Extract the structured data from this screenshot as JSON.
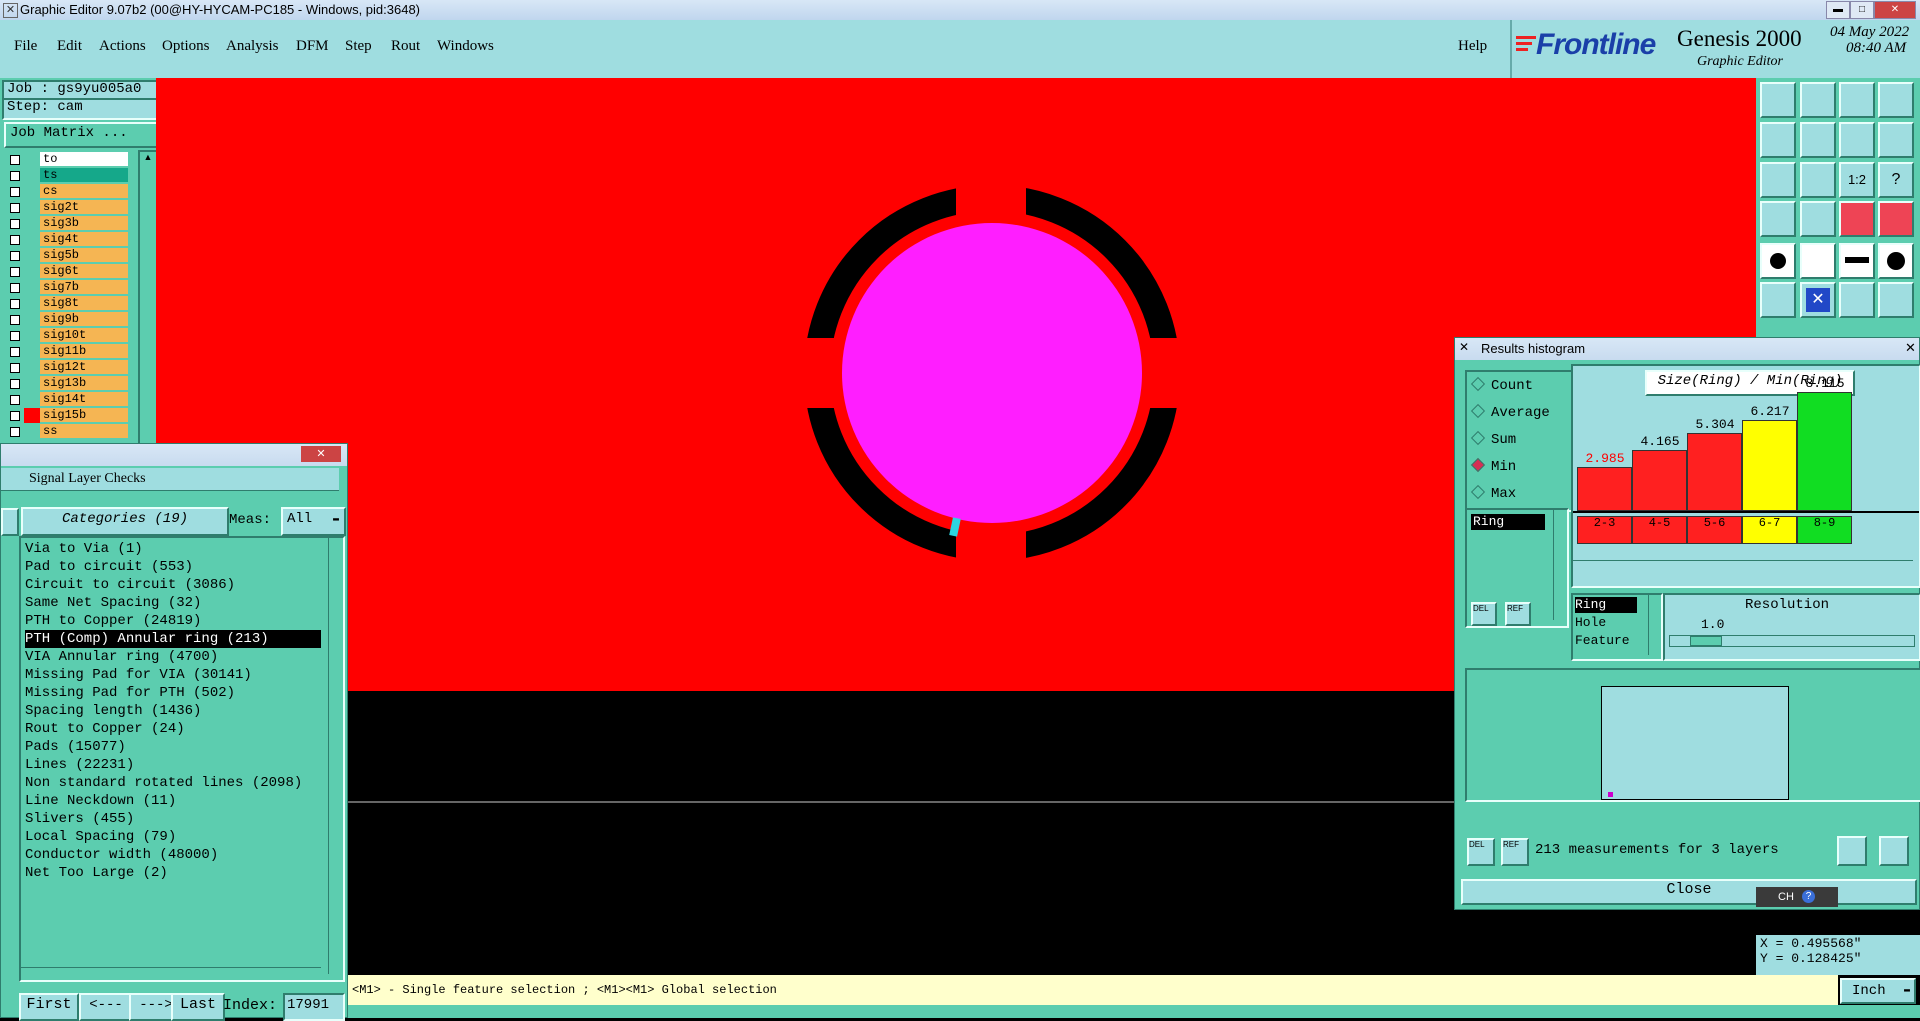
{
  "titlebar": {
    "title": "Graphic Editor 9.07b2 (00@HY-HYCAM-PC185 - Windows, pid:3648)"
  },
  "menu": [
    "File",
    "Edit",
    "Actions",
    "Options",
    "Analysis",
    "DFM",
    "Step",
    "Rout",
    "Windows"
  ],
  "help_label": "Help",
  "brand": {
    "logo": "Frontline",
    "product": "Genesis 2000",
    "subtitle": "Graphic Editor",
    "date": "04 May 2022",
    "time": "08:40 AM"
  },
  "job": {
    "job_label": "Job : gs9yu005a0",
    "step_label": "Step: cam",
    "matrix_button": "Job Matrix ..."
  },
  "layers": [
    {
      "name": "to",
      "color": "#ffffff"
    },
    {
      "name": "ts",
      "color": "#15a88a"
    },
    {
      "name": "cs",
      "color": "#f5b553"
    },
    {
      "name": "sig2t",
      "color": "#f5b553"
    },
    {
      "name": "sig3b",
      "color": "#f5b553"
    },
    {
      "name": "sig4t",
      "color": "#f5b553"
    },
    {
      "name": "sig5b",
      "color": "#f5b553"
    },
    {
      "name": "sig6t",
      "color": "#f5b553"
    },
    {
      "name": "sig7b",
      "color": "#f5b553"
    },
    {
      "name": "sig8t",
      "color": "#f5b553"
    },
    {
      "name": "sig9b",
      "color": "#f5b553"
    },
    {
      "name": "sig10t",
      "color": "#f5b553"
    },
    {
      "name": "sig11b",
      "color": "#f5b553"
    },
    {
      "name": "sig12t",
      "color": "#f5b553"
    },
    {
      "name": "sig13b",
      "color": "#f5b553"
    },
    {
      "name": "sig14t",
      "color": "#f5b553"
    },
    {
      "name": "sig15b",
      "color": "#f5b553",
      "active": true
    },
    {
      "name": "ss",
      "color": "#f5b553"
    }
  ],
  "checks": {
    "title": "Signal Layer Checks",
    "categories_label": "Categories (19)",
    "meas_label": "Meas:",
    "meas_value": "All",
    "items": [
      "Via to Via (1)",
      "Pad to circuit (553)",
      "Circuit to circuit (3086)",
      "Same Net Spacing (32)",
      "PTH to Copper (24819)",
      "PTH (Comp) Annular ring (213)",
      "VIA Annular ring (4700)",
      "Missing Pad for VIA (30141)",
      "Missing Pad for PTH (502)",
      "Spacing length (1436)",
      "Rout to Copper (24)",
      "Pads (15077)",
      "Lines (22231)",
      "Non standard rotated lines (2098)",
      "Line Neckdown (11)",
      "Slivers (455)",
      "Local Spacing (79)",
      "Conductor width (48000)",
      "Net Too Large (2)"
    ],
    "selected_index": 5,
    "nav": {
      "first": "First",
      "prev": "<---",
      "next": "--->",
      "last": "Last",
      "index_label": "Index:",
      "index_value": "17991"
    }
  },
  "histogram": {
    "title": "Results histogram",
    "header": "Size(Ring) / Min(Ring)",
    "modes": [
      "Count",
      "Average",
      "Sum",
      "Min",
      "Max"
    ],
    "selected_mode": "Min",
    "measure_list": [
      "Ring"
    ],
    "bars": [
      {
        "value": "2.985",
        "bin": "2-3",
        "color": "#ff2020",
        "label_color": "#ff0000"
      },
      {
        "value": "4.165",
        "bin": "4-5",
        "color": "#ff2020",
        "label_color": "#000000"
      },
      {
        "value": "5.304",
        "bin": "5-6",
        "color": "#ff2020",
        "label_color": "#000000"
      },
      {
        "value": "6.217",
        "bin": "6-7",
        "color": "#ffff00",
        "label_color": "#000000"
      },
      {
        "value": "8.115",
        "bin": "8-9",
        "color": "#11dd22",
        "label_color": "#000000"
      }
    ],
    "resolution_label": "Resolution",
    "resolution_value": "1.0",
    "sort_list": [
      "Ring",
      "Hole",
      "Feature"
    ],
    "measurements_text": "213 measurements for 3 layers",
    "close_label": "Close",
    "del_label": "DEL",
    "ref_label": "REF"
  },
  "coords": {
    "x": "X = 0.495568\"",
    "y": "Y = 0.128425\""
  },
  "status": {
    "text": "<M1> - Single feature selection ; <M1><M1> Global selection",
    "units": "Inch"
  },
  "ime": {
    "lang": "CH"
  }
}
